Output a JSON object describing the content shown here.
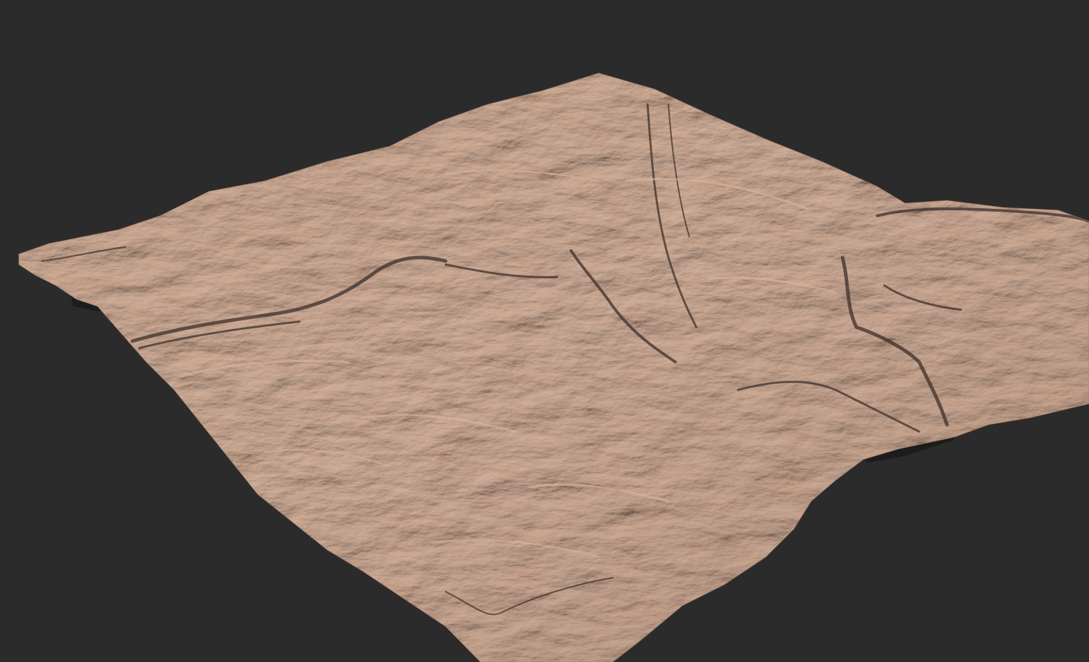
{
  "viewport": {
    "background_color": "#2b2b2c"
  },
  "terrain": {
    "base_color": "#b68a73",
    "light_color": "#d9ad92",
    "shadow_color": "#4a3c37",
    "side_color": "#1b1b1c"
  }
}
